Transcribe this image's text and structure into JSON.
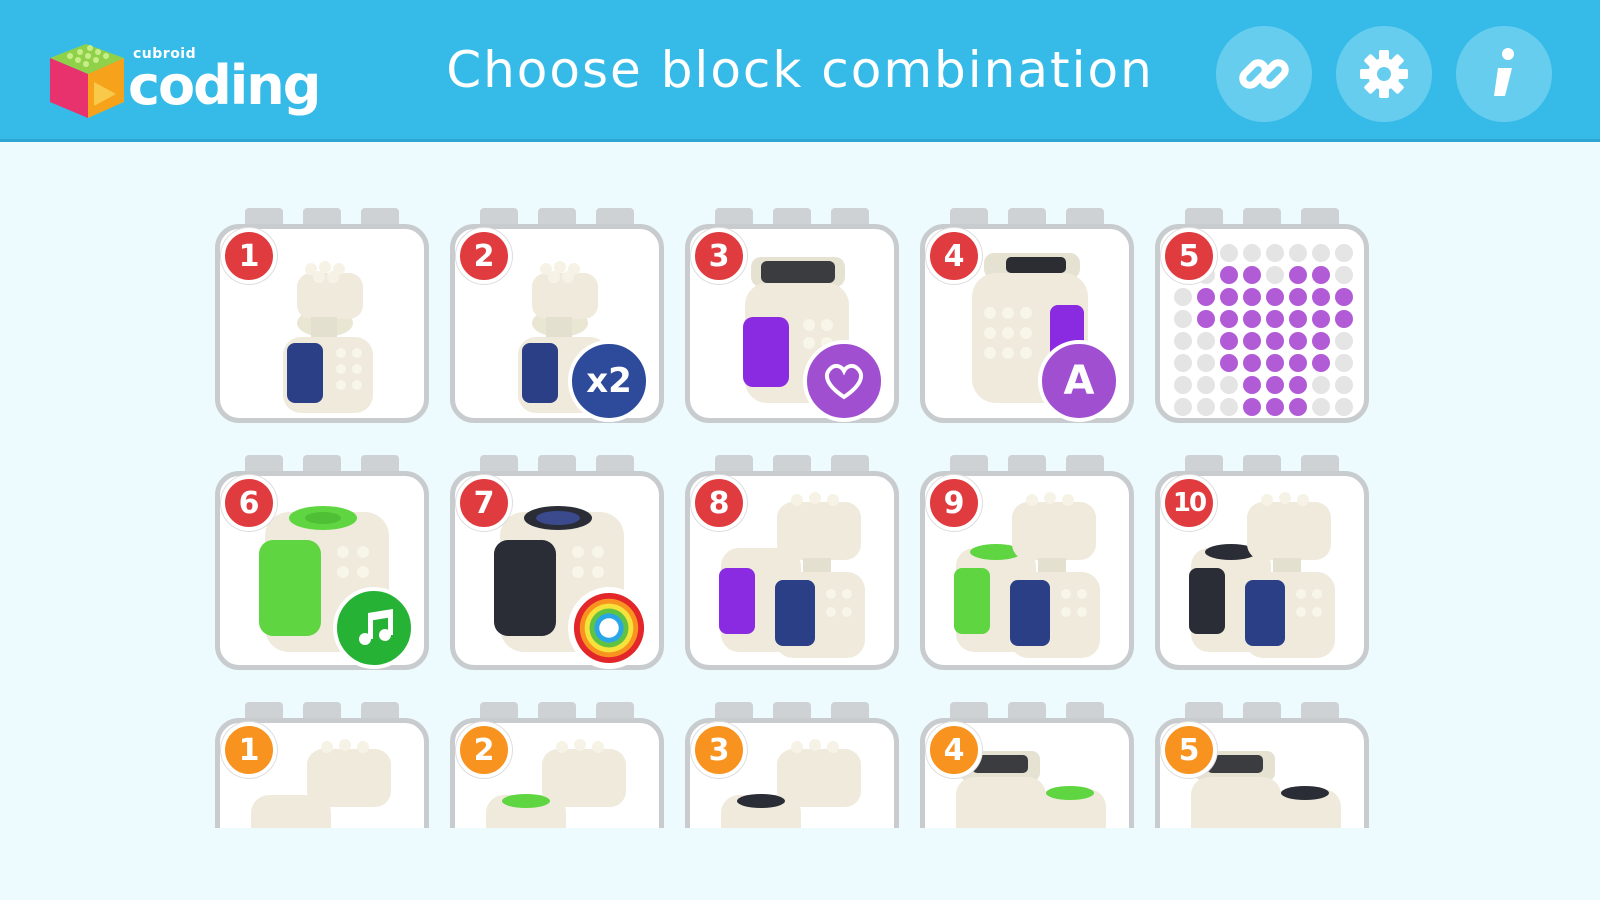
{
  "header": {
    "logo_small": "cubroid",
    "logo_main": "coding",
    "title": "Choose block combination",
    "buttons": [
      {
        "name": "link-button",
        "icon": "link-icon"
      },
      {
        "name": "settings-button",
        "icon": "gear-icon"
      },
      {
        "name": "info-button",
        "icon": "info-icon"
      }
    ]
  },
  "colors": {
    "header": "#36bbe8",
    "background": "#eefbfe",
    "number_red": "#e03c3f",
    "number_orange": "#f7931e",
    "purple": "#8a2be2",
    "green": "#5fd641",
    "navy": "#2b3f86",
    "black": "#2a2d35"
  },
  "cards": {
    "c1": {
      "number": "1"
    },
    "c2": {
      "number": "2",
      "badge": "x2"
    },
    "c3": {
      "number": "3",
      "badge_icon": "heart-icon"
    },
    "c4": {
      "number": "4",
      "badge": "A"
    },
    "c5": {
      "number": "5"
    },
    "c6": {
      "number": "6",
      "badge_icon": "music-note-icon"
    },
    "c7": {
      "number": "7",
      "badge_icon": "rainbow-icon"
    },
    "c8": {
      "number": "8"
    },
    "c9": {
      "number": "9"
    },
    "c10": {
      "number": "10"
    },
    "c11": {
      "number": "1"
    },
    "c12": {
      "number": "2"
    },
    "c13": {
      "number": "3"
    },
    "c14": {
      "number": "4"
    },
    "c15": {
      "number": "5"
    }
  }
}
